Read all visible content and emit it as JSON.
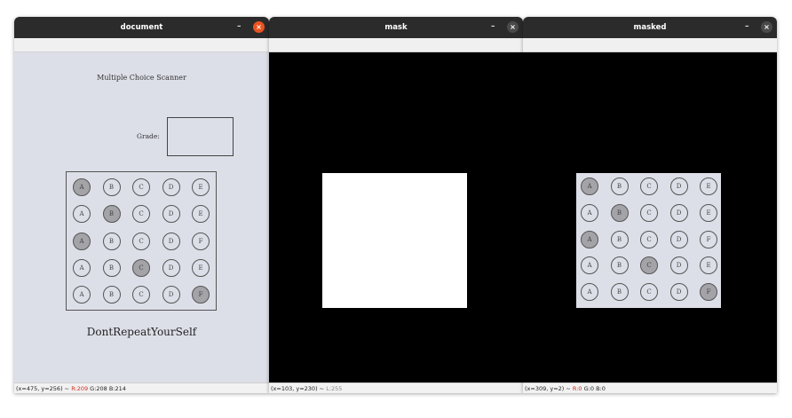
{
  "windows": [
    {
      "id": "document",
      "title": "document",
      "minimize_label": "–",
      "close_label": "×",
      "status": {
        "coords": "(x=475, y=256) ~ ",
        "r": "R:209",
        "g": " G:208",
        "b": " B:214"
      },
      "document": {
        "title": "Multiple Choice Scanner",
        "grade_label": "Grade:",
        "footer": "DontRepeatYourSelf"
      }
    },
    {
      "id": "mask",
      "title": "mask",
      "minimize_label": "–",
      "close_label": "×",
      "status": {
        "coords": "(x=103, y=230) ~ ",
        "l": "L:255"
      }
    },
    {
      "id": "masked",
      "title": "masked",
      "minimize_label": "–",
      "close_label": "×",
      "status": {
        "coords": "(x=309, y=2) ~ ",
        "r": "R:0",
        "g": " G:0",
        "b": " B:0"
      }
    }
  ],
  "bubble_sheet": {
    "choices": [
      "A",
      "B",
      "C",
      "D",
      "E"
    ],
    "rows": [
      {
        "labels": [
          "A",
          "B",
          "C",
          "D",
          "E"
        ],
        "filled": 0
      },
      {
        "labels": [
          "A",
          "B",
          "C",
          "D",
          "E"
        ],
        "filled": 1
      },
      {
        "labels": [
          "A",
          "B",
          "C",
          "D",
          "F"
        ],
        "filled": 0
      },
      {
        "labels": [
          "A",
          "B",
          "C",
          "D",
          "E"
        ],
        "filled": 2
      },
      {
        "labels": [
          "A",
          "B",
          "C",
          "D",
          "F"
        ],
        "filled": 4
      }
    ]
  },
  "colors": {
    "title_bar": "#2b2b2b",
    "close_active": "#e95420",
    "status_red": "#d22a1a",
    "paper": "#dddfe8",
    "bubble_fill": "#a3a3a8"
  },
  "icons": [
    "close-icon",
    "minimize-icon"
  ]
}
